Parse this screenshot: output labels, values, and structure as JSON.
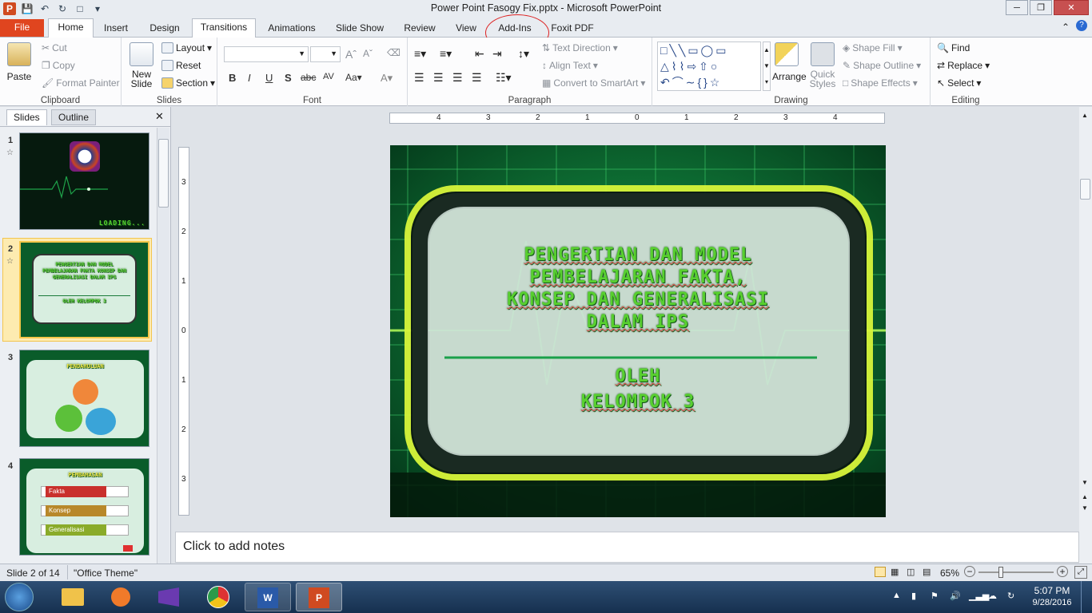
{
  "window": {
    "title": "Power Point Fasogy Fix.pptx - Microsoft PowerPoint"
  },
  "tabs": [
    "File",
    "Home",
    "Insert",
    "Design",
    "Transitions",
    "Animations",
    "Slide Show",
    "Review",
    "View",
    "Add-Ins",
    "Foxit PDF"
  ],
  "ribbon": {
    "clipboard": {
      "label": "Clipboard",
      "paste": "Paste",
      "cut": "Cut",
      "copy": "Copy",
      "format_painter": "Format Painter"
    },
    "slides": {
      "label": "Slides",
      "new_slide": "New Slide",
      "layout": "Layout",
      "reset": "Reset",
      "section": "Section"
    },
    "font": {
      "label": "Font"
    },
    "paragraph": {
      "label": "Paragraph",
      "text_direction": "Text Direction",
      "align_text": "Align Text",
      "convert": "Convert to SmartArt"
    },
    "drawing": {
      "label": "Drawing",
      "arrange": "Arrange",
      "quick_styles": "Quick Styles",
      "shape_fill": "Shape Fill",
      "shape_outline": "Shape Outline",
      "shape_effects": "Shape Effects"
    },
    "editing": {
      "label": "Editing",
      "find": "Find",
      "replace": "Replace",
      "select": "Select"
    }
  },
  "panel": {
    "tab_slides": "Slides",
    "tab_outline": "Outline",
    "thumbs": [
      {
        "num": "1",
        "text": "LOADING..."
      },
      {
        "num": "2",
        "text": "PENGERTIAN DAN MODEL PEMBELAJARAN FAKTA KONSEP DAN GENERALISASI DALAM IPS",
        "sub": "OLEH KELOMPOK 3"
      },
      {
        "num": "3",
        "text": "PENDAHULUAN"
      },
      {
        "num": "4",
        "text": "PEMBAHASAN",
        "items": [
          "Fakta",
          "Konsep",
          "Generalisasi"
        ]
      }
    ]
  },
  "ruler": {
    "h_labels": [
      "4",
      "3",
      "2",
      "1",
      "0",
      "1",
      "2",
      "3",
      "4"
    ],
    "v_labels": [
      "3",
      "2",
      "1",
      "0",
      "1",
      "2",
      "3"
    ]
  },
  "slide": {
    "title_lines": [
      "PENGERTIAN DAN MODEL",
      "PEMBELAJARAN FAKTA,",
      "KONSEP DAN GENERALISASI",
      "DALAM IPS"
    ],
    "sub_lines": [
      "OLEH",
      "KELOMPOK 3"
    ]
  },
  "notes": {
    "placeholder": "Click to add notes"
  },
  "status": {
    "slide_info": "Slide 2 of 14",
    "theme": "\"Office Theme\"",
    "zoom": "65%"
  },
  "taskbar": {
    "time": "5:07 PM",
    "date": "9/28/2016"
  },
  "colors": {
    "accent_file": "#e0451f",
    "slide_green": "#58d02f",
    "annotation_circle": "#dd2222"
  }
}
